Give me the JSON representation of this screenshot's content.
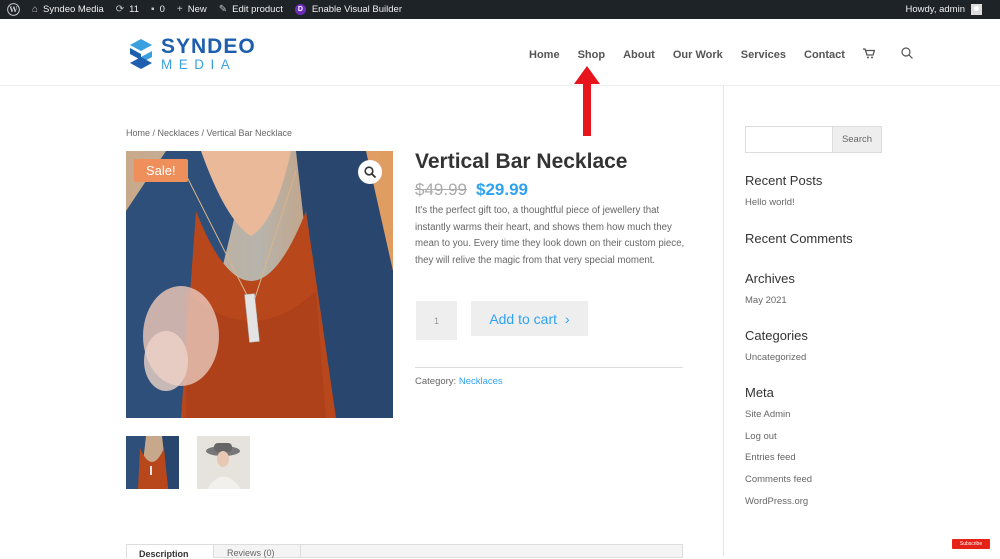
{
  "adminbar": {
    "site_name": "Syndeo Media",
    "updates_count": "11",
    "comments_count": "0",
    "new_label": "New",
    "edit_label": "Edit product",
    "visual_builder_label": "Enable Visual Builder",
    "divi_letter": "D",
    "howdy": "Howdy, admin"
  },
  "logo": {
    "line1": "SYNDEO",
    "line2": "MEDIA"
  },
  "nav": {
    "items": [
      "Home",
      "Shop",
      "About",
      "Our Work",
      "Services",
      "Contact"
    ]
  },
  "breadcrumb": "Home / Necklaces / Vertical Bar Necklace",
  "product": {
    "sale_badge": "Sale!",
    "title": "Vertical Bar Necklace",
    "old_price": "$49.99",
    "price": "$29.99",
    "description": "It's the perfect gift too, a thoughtful piece of jewellery that instantly warms their heart, and shows them how much they mean to you. Every time they look down on their custom piece, they will relive the magic from that very special moment.",
    "quantity": "1",
    "add_to_cart": "Add to cart",
    "category_label": "Category:",
    "category_value": "Necklaces"
  },
  "tabs": [
    "Description",
    "Reviews (0)"
  ],
  "sidebar": {
    "search_button": "Search",
    "recent_posts_title": "Recent Posts",
    "recent_posts": [
      "Hello world!"
    ],
    "recent_comments_title": "Recent Comments",
    "archives_title": "Archives",
    "archives": [
      "May 2021"
    ],
    "categories_title": "Categories",
    "categories": [
      "Uncategorized"
    ],
    "meta_title": "Meta",
    "meta_links": [
      "Site Admin",
      "Log out",
      "Entries feed",
      "Comments feed",
      "WordPress.org"
    ]
  },
  "youtube_badge": "Subscribe",
  "colors": {
    "accent": "#2ea3f2",
    "sale": "#ef8f5b",
    "arrow": "#e8141b",
    "adminbar": "#1d2327"
  }
}
